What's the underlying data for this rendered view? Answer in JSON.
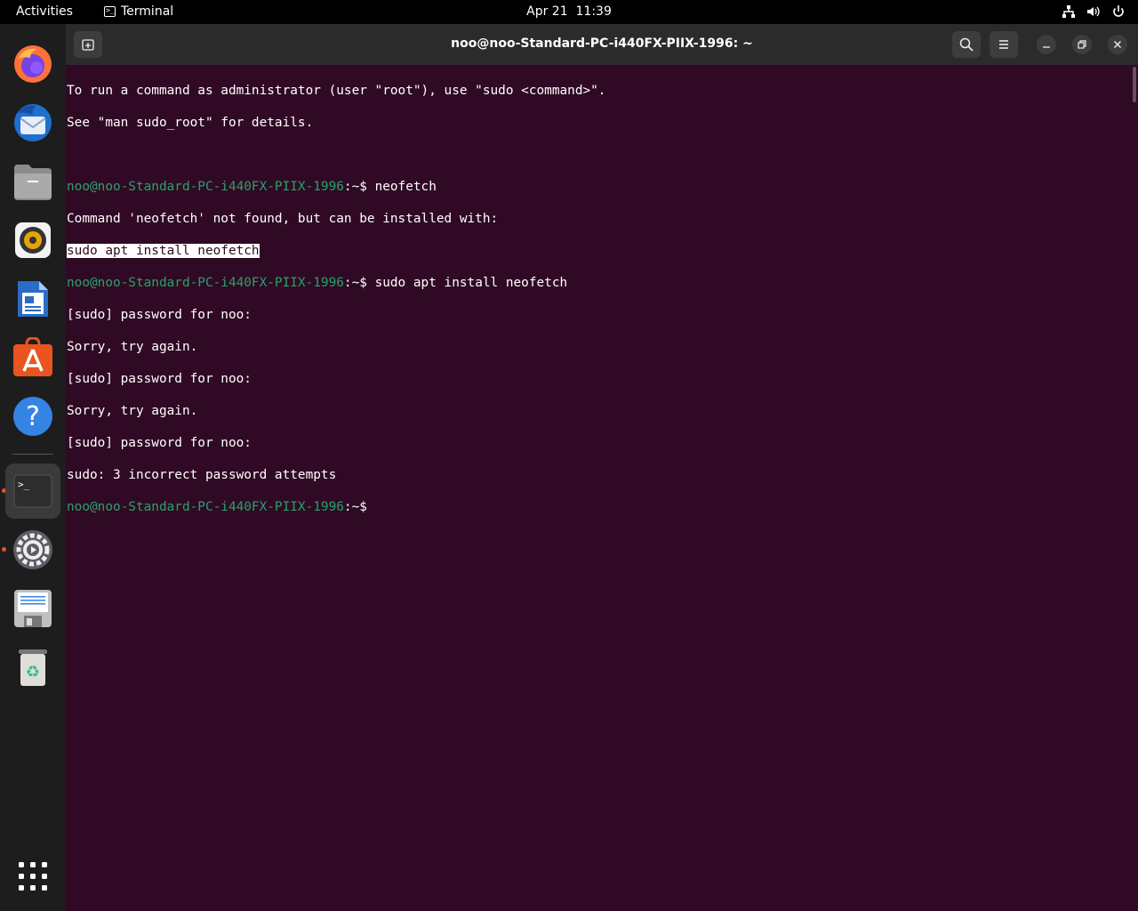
{
  "topbar": {
    "activities": "Activities",
    "app_name": "Terminal",
    "date": "Apr 21",
    "time": "11:39"
  },
  "dock": {
    "items": [
      {
        "name": "firefox",
        "icon": "firefox-icon"
      },
      {
        "name": "thunderbird",
        "icon": "thunderbird-icon"
      },
      {
        "name": "files",
        "icon": "files-icon"
      },
      {
        "name": "rhythmbox",
        "icon": "rhythmbox-icon"
      },
      {
        "name": "libreoffice-writer",
        "icon": "writer-icon"
      },
      {
        "name": "app-center",
        "icon": "app-center-icon"
      },
      {
        "name": "help",
        "icon": "help-icon"
      },
      {
        "name": "terminal",
        "icon": "terminal-icon",
        "running": true,
        "active": true
      },
      {
        "name": "settings",
        "icon": "settings-icon",
        "running": true
      },
      {
        "name": "save-disk",
        "icon": "disk-icon"
      },
      {
        "name": "trash",
        "icon": "trash-icon"
      },
      {
        "name": "show-apps",
        "icon": "apps-grid-icon"
      }
    ],
    "accent_color": "#e95420"
  },
  "window": {
    "title": "noo@noo-Standard-PC-i440FX-PIIX-1996: ~",
    "background": "#300a24",
    "prompt_color": "#26a269"
  },
  "terminal": {
    "user_host": "noo@noo-Standard-PC-i440FX-PIIX-1996",
    "prompt_suffix": ":~$ ",
    "lines": {
      "l1": "To run a command as administrator (user \"root\"), use \"sudo <command>\".",
      "l2": "See \"man sudo_root\" for details.",
      "cmd1": "neofetch",
      "l4": "Command 'neofetch' not found, but can be installed with:",
      "l5": "sudo apt install neofetch",
      "cmd2": "sudo apt install neofetch",
      "l7": "[sudo] password for noo:",
      "l8": "Sorry, try again.",
      "l9": "[sudo] password for noo:",
      "l10": "Sorry, try again.",
      "l11": "[sudo] password for noo:",
      "l12": "sudo: 3 incorrect password attempts"
    }
  }
}
